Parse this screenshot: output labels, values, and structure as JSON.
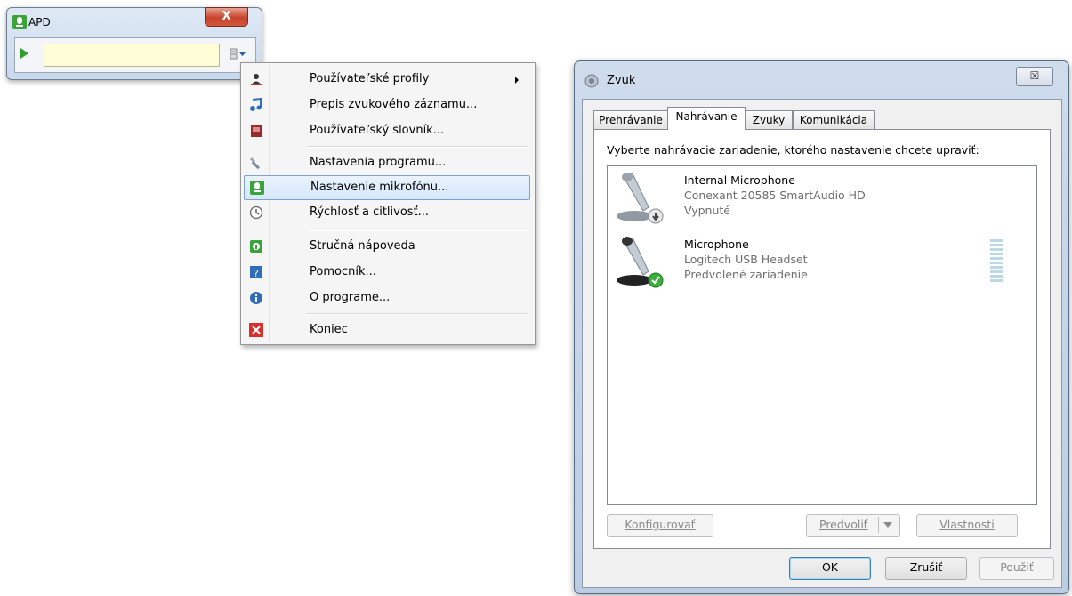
{
  "apd": {
    "title": "APD",
    "close_label": "X"
  },
  "menu": {
    "items": [
      {
        "label": "Používateľské profily",
        "icon": "user-profile-icon"
      },
      {
        "label": "Prepis zvukového záznamu...",
        "icon": "transcription-icon"
      },
      {
        "label": "Používateľský slovník...",
        "icon": "dictionary-icon"
      },
      {
        "label": "Nastavenia programu...",
        "icon": "wrench-icon"
      },
      {
        "label": "Nastavenie mikrofónu...",
        "icon": "microphone-icon"
      },
      {
        "label": "Rýchlosť a citlivosť...",
        "icon": "clock-icon"
      },
      {
        "label": "Stručná nápoveda",
        "icon": "quick-help-icon"
      },
      {
        "label": "Pomocník...",
        "icon": "help-book-icon"
      },
      {
        "label": "O programe...",
        "icon": "info-icon"
      },
      {
        "label": "Koniec",
        "icon": "exit-icon"
      }
    ],
    "highlighted_index": 4
  },
  "dialog": {
    "title": "Zvuk",
    "close_label": "☒",
    "tabs": [
      "Prehrávanie",
      "Nahrávanie",
      "Zvuky",
      "Komunikácia"
    ],
    "active_tab": 1,
    "prompt": "Vyberte nahrávacie zariadenie, ktorého nastavenie chcete upraviť:",
    "devices": [
      {
        "name": "Internal Microphone",
        "driver": "Conexant 20585 SmartAudio HD",
        "status": "Vypnuté"
      },
      {
        "name": "Microphone",
        "driver": "Logitech USB Headset",
        "status": "Predvolené zariadenie"
      }
    ],
    "buttons": {
      "configure": "Konfigurovať",
      "set_default": "Predvoliť",
      "properties": "Vlastnosti",
      "ok": "OK",
      "cancel": "Zrušiť",
      "apply": "Použiť"
    }
  }
}
